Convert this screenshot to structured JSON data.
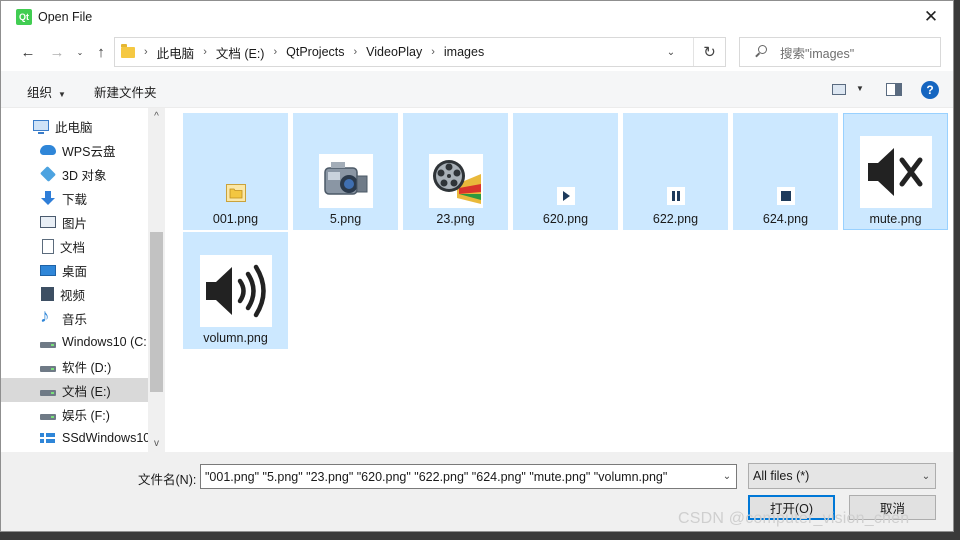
{
  "window": {
    "title": "Open File",
    "logo_text": "Qt",
    "close_glyph": "✕"
  },
  "address": {
    "back_glyph": "←",
    "forward_glyph": "→",
    "up_glyph": "↑",
    "crumbs": [
      "此电脑",
      "文档 (E:)",
      "QtProjects",
      "VideoPlay",
      "images"
    ],
    "separator": "›",
    "dropdown_glyph": "⌄",
    "refresh_glyph": "↻"
  },
  "search": {
    "placeholder": "搜索\"images\""
  },
  "toolbar": {
    "organize_label": "组织",
    "new_folder_label": "新建文件夹",
    "help_glyph": "?"
  },
  "sidebar": {
    "items": [
      {
        "label": "此电脑",
        "icon": "computer-icon"
      },
      {
        "label": "WPS云盘",
        "icon": "cloud-icon"
      },
      {
        "label": "3D 对象",
        "icon": "3d-objects-icon"
      },
      {
        "label": "下载",
        "icon": "download-icon"
      },
      {
        "label": "图片",
        "icon": "pictures-icon"
      },
      {
        "label": "文档",
        "icon": "documents-icon"
      },
      {
        "label": "桌面",
        "icon": "desktop-icon"
      },
      {
        "label": "视频",
        "icon": "videos-icon"
      },
      {
        "label": "音乐",
        "icon": "music-icon"
      },
      {
        "label": "Windows10 (C:",
        "icon": "drive-icon"
      },
      {
        "label": "软件 (D:)",
        "icon": "drive-icon"
      },
      {
        "label": "文档 (E:)",
        "icon": "drive-icon",
        "selected": true
      },
      {
        "label": "娱乐 (F:)",
        "icon": "drive-icon"
      },
      {
        "label": "SSdWindows10",
        "icon": "ssd-icon"
      }
    ],
    "scroll_up_glyph": "^",
    "scroll_down_glyph": "v"
  },
  "files": [
    {
      "name": "001.png",
      "icon": "folder-thumbnail"
    },
    {
      "name": "5.png",
      "icon": "camcorder-thumbnail"
    },
    {
      "name": "23.png",
      "icon": "film-reel-thumbnail"
    },
    {
      "name": "620.png",
      "icon": "play-thumbnail"
    },
    {
      "name": "622.png",
      "icon": "pause-thumbnail"
    },
    {
      "name": "624.png",
      "icon": "stop-thumbnail"
    },
    {
      "name": "mute.png",
      "icon": "mute-speaker-thumbnail"
    },
    {
      "name": "volumn.png",
      "icon": "volume-speaker-thumbnail"
    }
  ],
  "bottom": {
    "filename_label": "文件名(N):",
    "filename_value": "\"001.png\" \"5.png\" \"23.png\" \"620.png\" \"622.png\" \"624.png\" \"mute.png\" \"volumn.png\"",
    "filter_value": "All files  (*)",
    "open_label": "打开(O)",
    "cancel_label": "取消"
  },
  "watermark": "CSDN @computer_vision_chen",
  "colors": {
    "selection": "#cce8ff",
    "accent": "#0078d7",
    "qt_green": "#41cd52"
  }
}
